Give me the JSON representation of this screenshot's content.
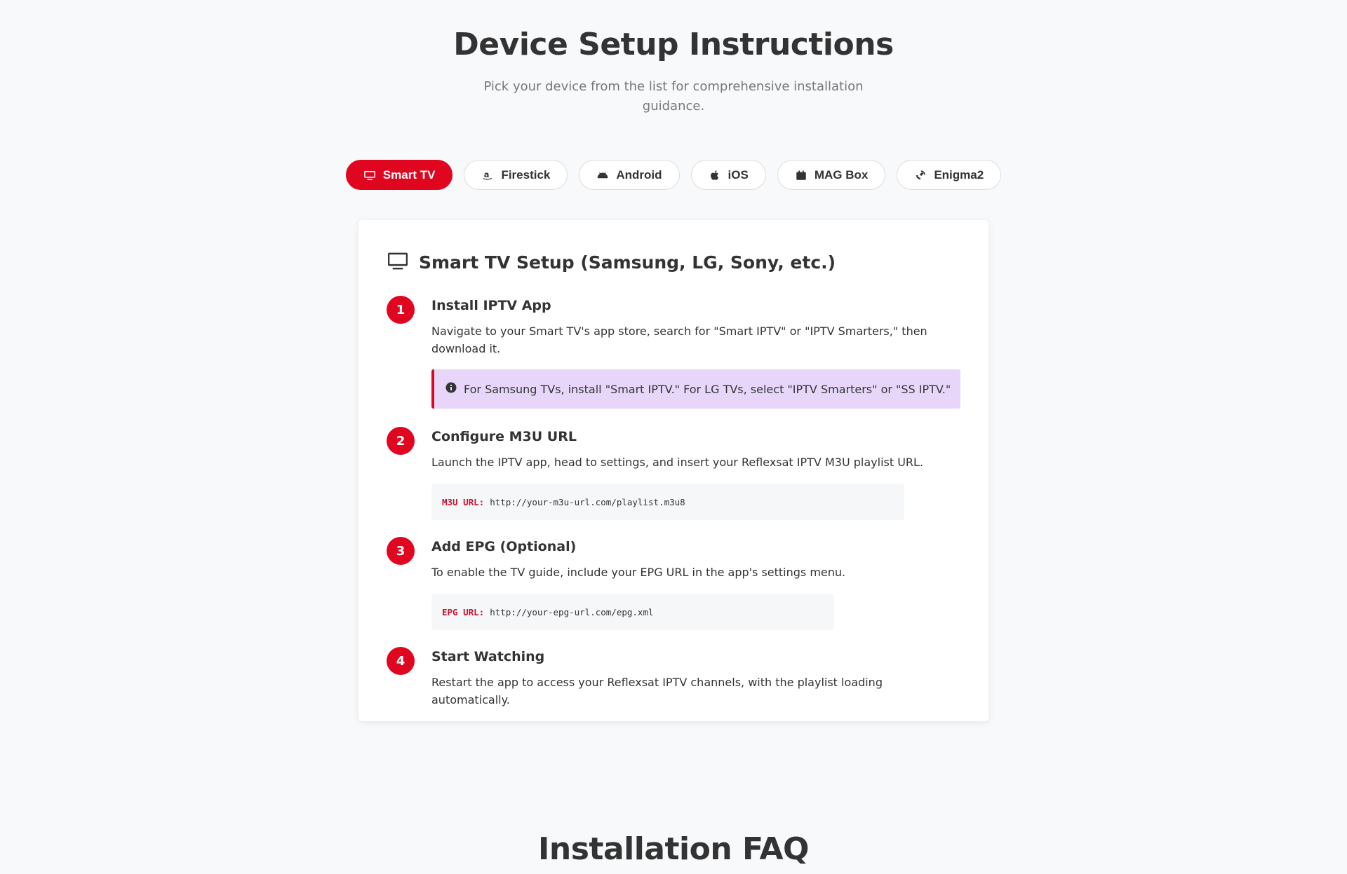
{
  "header": {
    "title": "Device Setup Instructions",
    "subtitle": "Pick your device from the list for comprehensive installation guidance."
  },
  "tabs": [
    {
      "label": "Smart TV",
      "icon": "tv-icon",
      "active": true
    },
    {
      "label": "Firestick",
      "icon": "amazon-icon",
      "active": false
    },
    {
      "label": "Android",
      "icon": "android-icon",
      "active": false
    },
    {
      "label": "iOS",
      "icon": "apple-icon",
      "active": false
    },
    {
      "label": "MAG Box",
      "icon": "box-icon",
      "active": false
    },
    {
      "label": "Enigma2",
      "icon": "satellite-icon",
      "active": false
    }
  ],
  "card": {
    "title": "Smart TV Setup (Samsung, LG, Sony, etc.)",
    "icon": "tv-icon",
    "steps": [
      {
        "number": "1",
        "title": "Install IPTV App",
        "text": "Navigate to your Smart TV's app store, search for \"Smart IPTV\" or \"IPTV Smarters,\" then download it.",
        "note": "For Samsung TVs, install \"Smart IPTV.\" For LG TVs, select \"IPTV Smarters\" or \"SS IPTV.\""
      },
      {
        "number": "2",
        "title": "Configure M3U URL",
        "text": "Launch the IPTV app, head to settings, and insert your Reflexsat IPTV M3U playlist URL.",
        "code_label": "M3U URL:",
        "code_value": "http://your-m3u-url.com/playlist.m3u8"
      },
      {
        "number": "3",
        "title": "Add EPG (Optional)",
        "text": "To enable the TV guide, include your EPG URL in the app's settings menu.",
        "code_label": "EPG URL:",
        "code_value": "http://your-epg-url.com/epg.xml"
      },
      {
        "number": "4",
        "title": "Start Watching",
        "text": "Restart the app to access your Reflexsat IPTV channels, with the playlist loading automatically."
      }
    ]
  },
  "faq": {
    "title": "Installation FAQ"
  },
  "colors": {
    "accent": "#e0061f",
    "note_bg": "#e7d6f9",
    "page_bg": "#f8f9fa"
  }
}
